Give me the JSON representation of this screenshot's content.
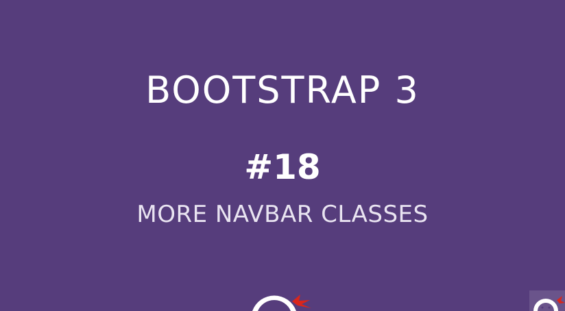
{
  "slide": {
    "title": "BOOTSTRAP 3",
    "episode": "#18",
    "subtitle": "MORE NAVBAR CLASSES"
  },
  "colors": {
    "background": "#563d7c",
    "text": "#ffffff",
    "subtitle_text": "#e9e4f1",
    "accent_red": "#d9261c"
  },
  "icons": {
    "logo": "ninja-logo-icon",
    "corner": "ninja-mascot-icon"
  }
}
